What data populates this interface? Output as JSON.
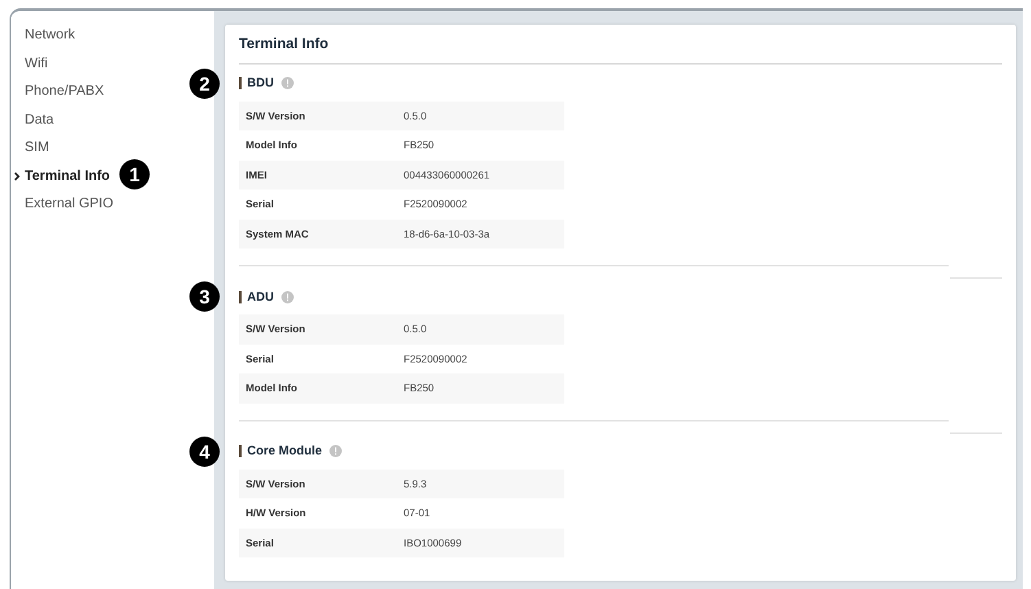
{
  "sidebar": {
    "items": [
      {
        "label": "Network",
        "selected": false
      },
      {
        "label": "Wifi",
        "selected": false
      },
      {
        "label": "Phone/PABX",
        "selected": false
      },
      {
        "label": "Data",
        "selected": false
      },
      {
        "label": "SIM",
        "selected": false
      },
      {
        "label": "Terminal Info",
        "selected": true,
        "callout": "1"
      },
      {
        "label": "External GPIO",
        "selected": false
      }
    ]
  },
  "panel": {
    "title": "Terminal Info"
  },
  "sections": [
    {
      "title": "BDU",
      "callout": "2",
      "rows": [
        {
          "label": "S/W Version",
          "value": "0.5.0"
        },
        {
          "label": "Model Info",
          "value": "FB250"
        },
        {
          "label": "IMEI",
          "value": "004433060000261"
        },
        {
          "label": "Serial",
          "value": "F2520090002"
        },
        {
          "label": "System MAC",
          "value": "18-d6-6a-10-03-3a"
        }
      ]
    },
    {
      "title": "ADU",
      "callout": "3",
      "rows": [
        {
          "label": "S/W Version",
          "value": "0.5.0"
        },
        {
          "label": "Serial",
          "value": "F2520090002"
        },
        {
          "label": "Model Info",
          "value": "FB250"
        }
      ]
    },
    {
      "title": "Core Module",
      "callout": "4",
      "rows": [
        {
          "label": "S/W Version",
          "value": "5.9.3"
        },
        {
          "label": "H/W Version",
          "value": "07-01"
        },
        {
          "label": "Serial",
          "value": "IBO1000699"
        }
      ]
    }
  ]
}
